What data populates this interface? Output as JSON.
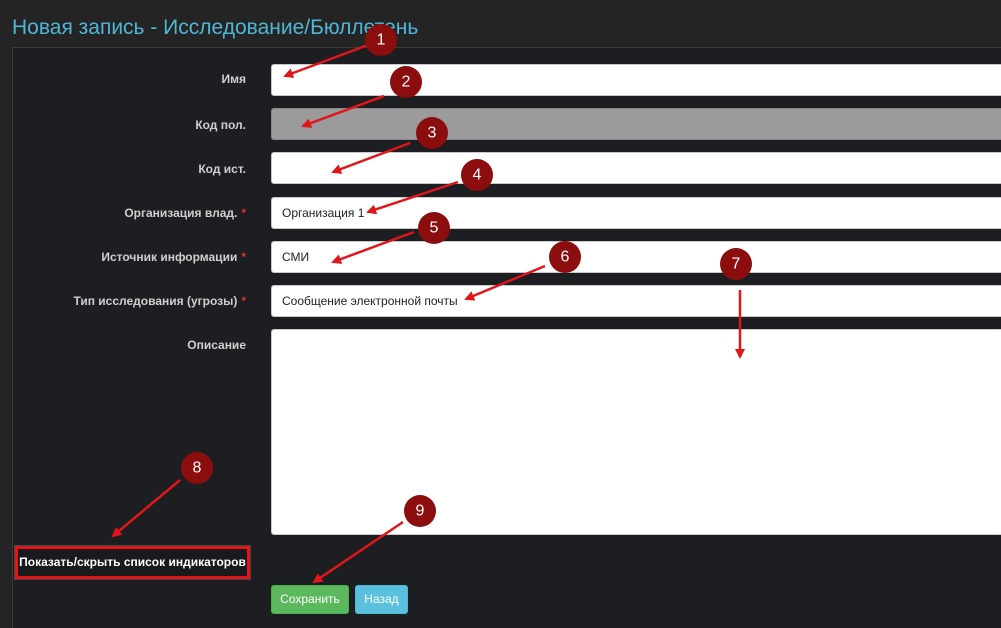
{
  "page": {
    "title": "Новая запись - Исследование/Бюллетень"
  },
  "form": {
    "name": {
      "label": "Имя",
      "value": ""
    },
    "field_code": {
      "label": "Код пол.",
      "value": ""
    },
    "source_code": {
      "label": "Код ист.",
      "value": ""
    },
    "owner_org": {
      "label": "Организация влад.",
      "required_mark": "*",
      "value": "Организация 1"
    },
    "info_source": {
      "label": "Источник информации",
      "required_mark": "*",
      "value": "СМИ"
    },
    "research_type": {
      "label": "Тип исследования (угрозы)",
      "required_mark": "*",
      "value": "Сообщение электронной почты"
    },
    "description": {
      "label": "Описание",
      "value": ""
    }
  },
  "buttons": {
    "toggle_indicators": "Показать/скрыть список индикаторов",
    "save": "Сохранить",
    "back": "Назад"
  },
  "annotations": {
    "badge_color": "#8b0d0d",
    "arrow_color": "#e0161b",
    "numbers": [
      "1",
      "2",
      "3",
      "4",
      "5",
      "6",
      "7",
      "8",
      "9"
    ]
  }
}
